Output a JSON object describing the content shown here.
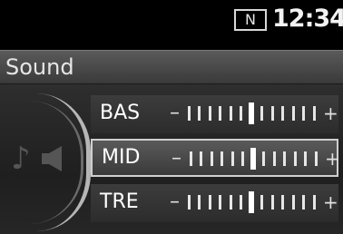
{
  "status": {
    "compass": "N",
    "time": "12:34"
  },
  "header": {
    "title": "Sound"
  },
  "icons": {
    "left": "music-note-icon",
    "right": "speaker-icon"
  },
  "rows": [
    {
      "id": "bas",
      "label": "BAS",
      "minus": "–",
      "plus": "+",
      "level": 0
    },
    {
      "id": "mid",
      "label": "MID",
      "minus": "–",
      "plus": "+",
      "level": 0,
      "selected": true
    },
    {
      "id": "tre",
      "label": "TRE",
      "minus": "–",
      "plus": "+",
      "level": 0
    }
  ],
  "scale": {
    "steps_each_side": 6
  }
}
